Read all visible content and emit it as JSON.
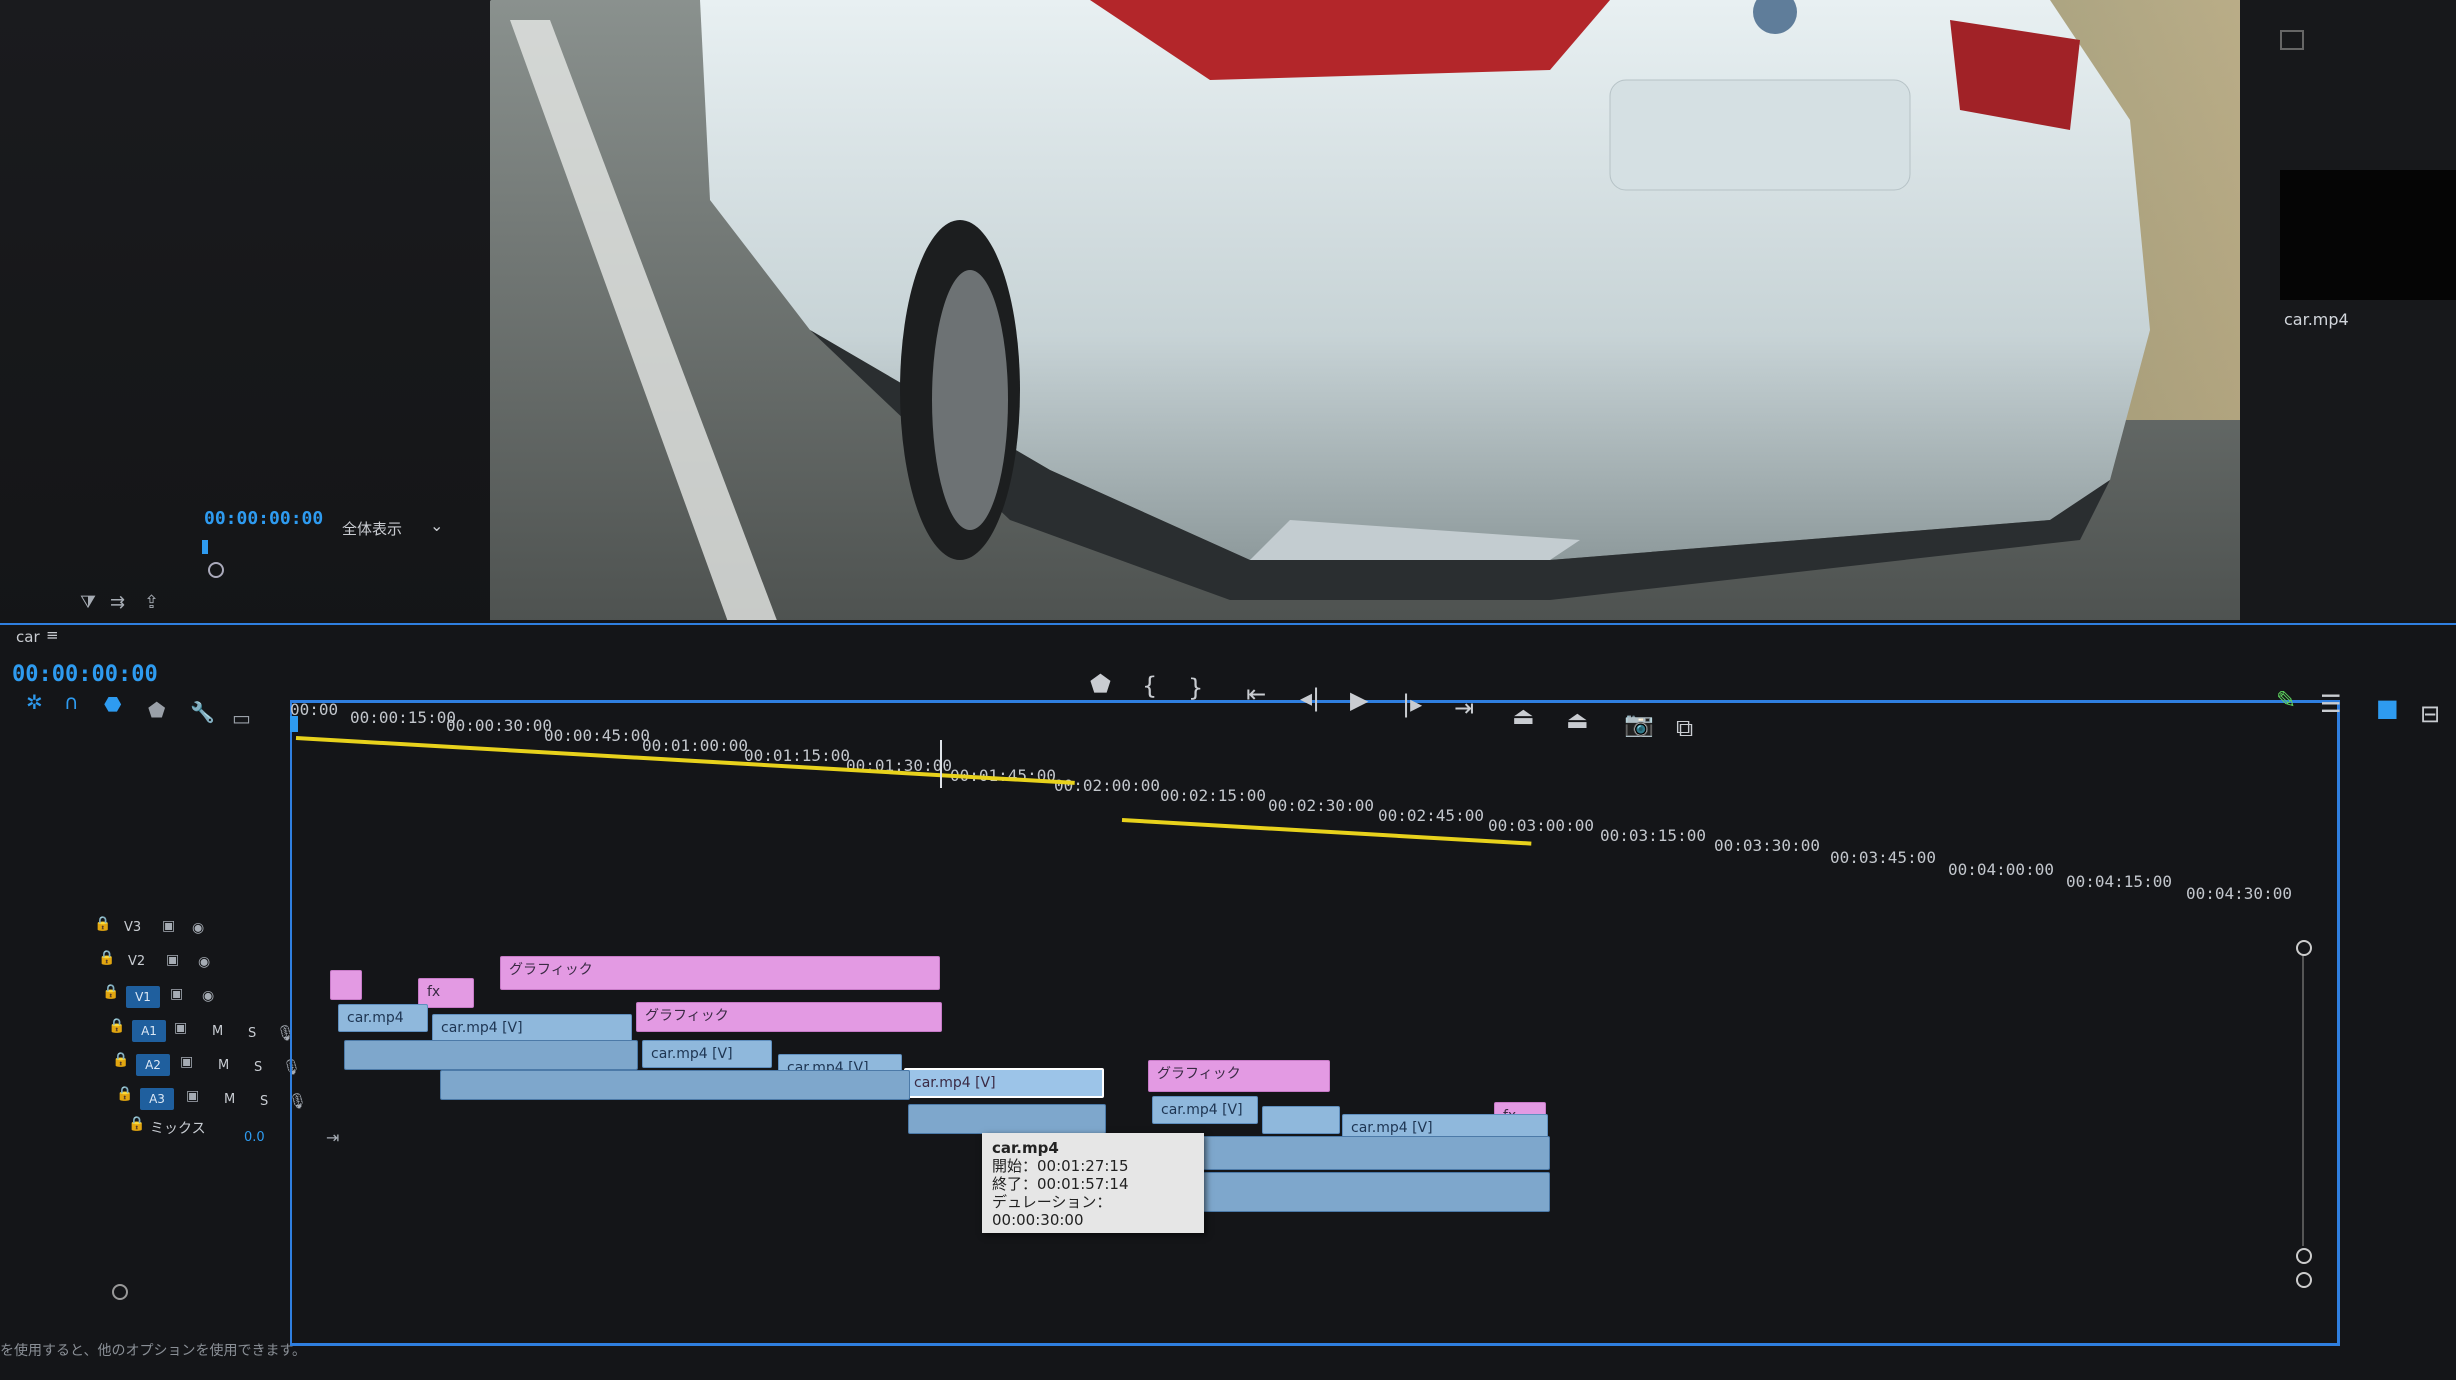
{
  "program_monitor": {
    "timecode": "00:00:00:00",
    "zoom_label": "全体表示",
    "zoom_arrow": "⌄"
  },
  "project_panel": {
    "clip_name": "car.mp4"
  },
  "timeline": {
    "sequence_tab": "car",
    "tab_menu_icon": "≡",
    "playhead_timecode": "00:00:00:00",
    "ruler": [
      "00:00",
      "00:00:15:00",
      "00:00:30:00",
      "00:00:45:00",
      "00:01:00:00",
      "00:01:15:00",
      "00:01:30:00",
      "00:01:45:00",
      "00:02:00:00",
      "00:02:15:00",
      "00:02:30:00",
      "00:02:45:00",
      "00:03:00:00",
      "00:03:15:00",
      "00:03:30:00",
      "00:03:45:00",
      "00:04:00:00",
      "00:04:15:00",
      "00:04:30:00"
    ],
    "tracks": {
      "v3": "V3",
      "v2": "V2",
      "v1": "V1",
      "a1": "A1",
      "a2": "A2",
      "a3": "A3",
      "mix": "ミックス",
      "mix_value": "0.0",
      "m": "M",
      "s": "S"
    },
    "clips": {
      "graphic": "グラフィック",
      "car": "car.mp4",
      "car_v": "car.mp4 [V]",
      "fx": "fx"
    },
    "tooltip": {
      "name": "car.mp4",
      "start": "開始：00:01:27:15",
      "end": "終了：00:01:57:14",
      "duration": "デュレーション：00:00:30:00"
    },
    "status_text": "を使用すると、他のオプションを使用できます。"
  },
  "colors": {
    "accent_blue": "#2f7fe0",
    "graphic_clip": "#e39ae3",
    "video_clip": "#8fb8dc",
    "render_bar": "#e8d21c"
  }
}
